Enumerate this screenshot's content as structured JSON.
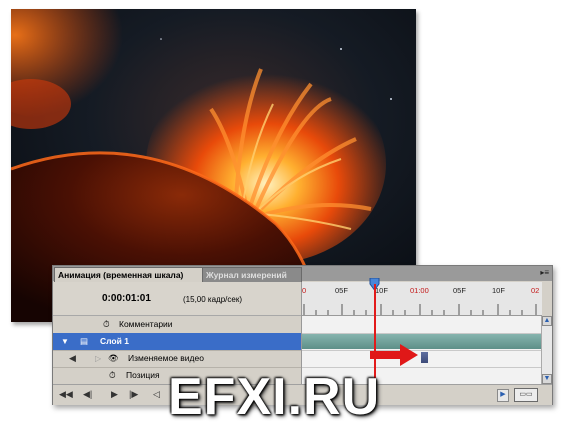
{
  "tabs": {
    "active": "Анимация (временная шкала)",
    "inactive": "Журнал измерений",
    "menu_icon": "panel-menu-icon"
  },
  "timeline": {
    "timecode": "0:00:01:01",
    "fps": "(15,00 кадр/сек)",
    "ruler_labels": [
      "0",
      "05F",
      "10F",
      "01:00",
      "05F",
      "10F",
      "02"
    ],
    "current_frame_label": "01:00"
  },
  "layers": {
    "comments": "Комментарии",
    "layer1": "Слой 1",
    "video": "Изменяемое видео",
    "position": "Позиция"
  },
  "icons": {
    "stopwatch": "stopwatch-icon",
    "eye": "eye-icon",
    "film": "film-icon",
    "expand": "triangle-down-icon"
  },
  "colors": {
    "selected_row": "#3a6dc8",
    "track": "#6a9c95",
    "playhead": "#e21a1a"
  },
  "watermark": "EFXI.RU"
}
